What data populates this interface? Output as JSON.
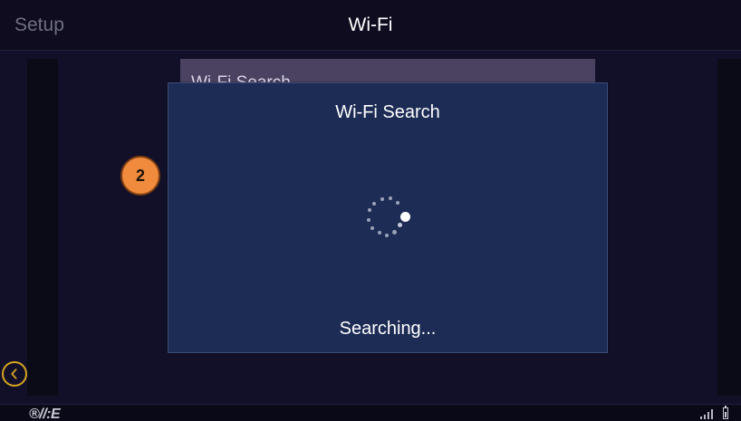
{
  "header": {
    "left_label": "Setup",
    "title": "Wi-Fi"
  },
  "background_list": {
    "items": [
      {
        "label": "Wi-Fi Search"
      }
    ]
  },
  "modal": {
    "title": "Wi-Fi Search",
    "status": "Searching..."
  },
  "step_badge": {
    "number": "2"
  },
  "footer": {
    "logo": "®//:E"
  },
  "icons": {
    "back": "back-chevron-icon",
    "spinner": "loading-spinner-icon",
    "signal": "signal-bars-icon",
    "battery": "battery-icon"
  },
  "colors": {
    "background": "#121028",
    "header": "#0e0c1e",
    "modal": "#1d2c55",
    "modal_border": "#3c4c78",
    "accent_gold": "#d6a421",
    "badge_orange": "#f08a3c",
    "title_text": "#ffffff",
    "header_muted": "#6f6f80"
  }
}
